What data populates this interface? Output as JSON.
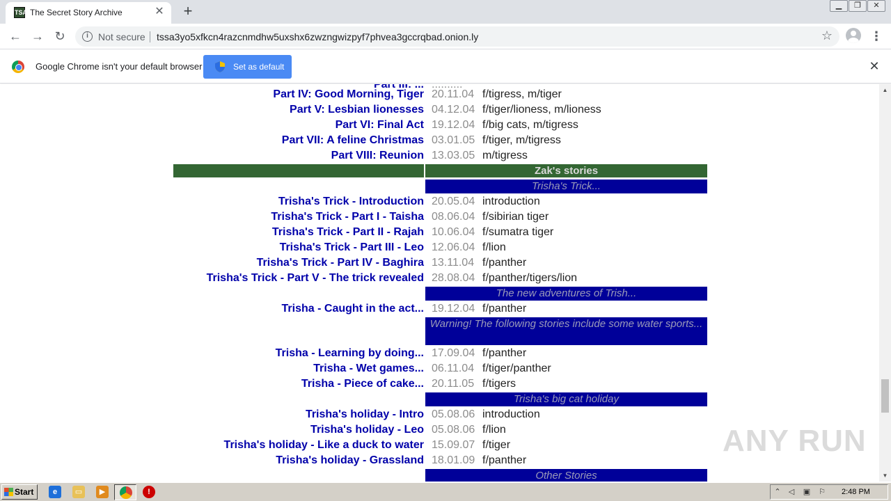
{
  "browser": {
    "tab_title": "The Secret Story Archive",
    "tab_favicon_text": "TSA",
    "new_tab_symbol": "+",
    "close_symbol": "✕",
    "security_label": "Not secure",
    "url": "tssa3yo5xfkcn4razcnmdhw5uxshx6zwzngwizpyf7phvea3gccrqbad.onion.ly",
    "infobar_text": "Google Chrome isn't your default browser",
    "set_default_label": "Set as default"
  },
  "page": {
    "rows_top": [
      {
        "title": "Part IV: Good Morning, Tiger",
        "date": "20.11.04",
        "tags": "f/tigress, m/tiger"
      },
      {
        "title": "Part V: Lesbian lionesses",
        "date": "04.12.04",
        "tags": "f/tiger/lioness, m/lioness"
      },
      {
        "title": "Part VI: Final Act",
        "date": "19.12.04",
        "tags": "f/big cats, m/tigress"
      },
      {
        "title": "Part VII: A feline Christmas",
        "date": "03.01.05",
        "tags": "f/tiger, m/tigress"
      },
      {
        "title": "Part VIII: Reunion",
        "date": "13.03.05",
        "tags": "m/tigress"
      }
    ],
    "section_title": "Zak's stories",
    "subheads": [
      "Trisha's Trick...",
      "The new adventures of Trish...",
      "Warning! The following stories include some water sports...",
      "Trisha's big cat holiday",
      "Other Stories"
    ],
    "group_trick": [
      {
        "title": "Trisha's Trick - Introduction",
        "date": "20.05.04",
        "tags": "introduction"
      },
      {
        "title": "Trisha's Trick - Part I - Taisha",
        "date": "08.06.04",
        "tags": "f/sibirian tiger"
      },
      {
        "title": "Trisha's Trick - Part II - Rajah",
        "date": "10.06.04",
        "tags": "f/sumatra tiger"
      },
      {
        "title": "Trisha's Trick - Part III - Leo",
        "date": "12.06.04",
        "tags": "f/lion"
      },
      {
        "title": "Trisha's Trick - Part IV - Baghira",
        "date": "13.11.04",
        "tags": "f/panther"
      },
      {
        "title": "Trisha's Trick - Part V - The trick revealed",
        "date": "28.08.04",
        "tags": "f/panther/tigers/lion"
      }
    ],
    "group_adventures": [
      {
        "title": "Trisha - Caught in the act...",
        "date": "19.12.04",
        "tags": "f/panther"
      }
    ],
    "group_water": [
      {
        "title": "Trisha - Learning by doing...",
        "date": "17.09.04",
        "tags": "f/panther"
      },
      {
        "title": "Trisha - Wet games...",
        "date": "06.11.04",
        "tags": "f/tiger/panther"
      },
      {
        "title": "Trisha - Piece of cake...",
        "date": "20.11.05",
        "tags": "f/tigers"
      }
    ],
    "group_holiday": [
      {
        "title": "Trisha's holiday - Intro",
        "date": "05.08.06",
        "tags": "introduction"
      },
      {
        "title": "Trisha's holiday - Leo",
        "date": "05.08.06",
        "tags": "f/lion"
      },
      {
        "title": "Trisha's holiday - Like a duck to water",
        "date": "15.09.07",
        "tags": "f/tiger"
      },
      {
        "title": "Trisha's holiday - Grassland",
        "date": "18.01.09",
        "tags": "f/panther"
      }
    ],
    "watermark": "ANY RUN"
  },
  "taskbar": {
    "start_label": "Start",
    "clock": "2:48 PM"
  },
  "colors": {
    "link": "#0000aa",
    "section_green": "#336633",
    "subhead_blue": "#000099",
    "date_gray": "#8c8c8c"
  },
  "icons": [
    "info-icon",
    "star-icon",
    "profile-icon",
    "menu-icon",
    "chrome-logo-icon",
    "shield-icon",
    "close-icon",
    "back-icon",
    "forward-icon",
    "reload-icon"
  ]
}
